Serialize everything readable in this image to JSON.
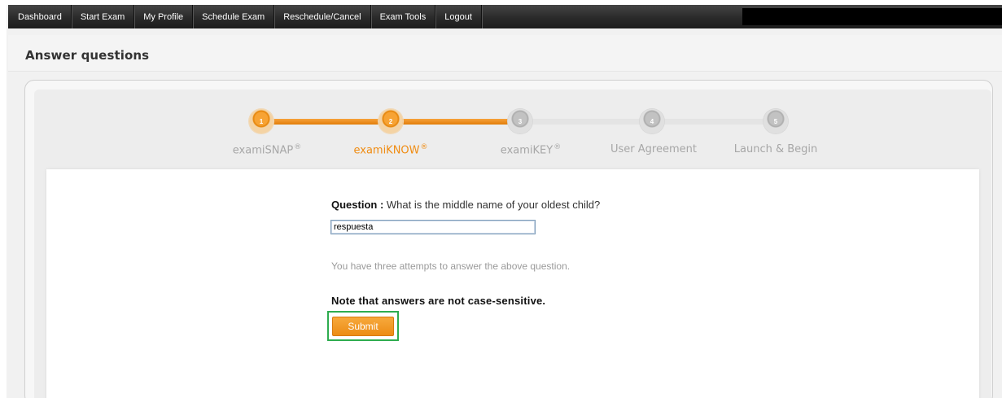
{
  "navbar": {
    "items": [
      "Dashboard",
      "Start Exam",
      "My Profile",
      "Schedule Exam",
      "Reschedule/Cancel",
      "Exam Tools",
      "Logout"
    ]
  },
  "page": {
    "title": "Answer questions"
  },
  "stepper": {
    "steps": [
      {
        "number": "1",
        "label": "examiSNAP",
        "mark": "®",
        "state": "done"
      },
      {
        "number": "2",
        "label": "examiKNOW",
        "mark": "®",
        "state": "active"
      },
      {
        "number": "3",
        "label": "examiKEY",
        "mark": "®",
        "state": "todo"
      },
      {
        "number": "4",
        "label": "User Agreement",
        "mark": "",
        "state": "todo"
      },
      {
        "number": "5",
        "label": "Launch & Begin",
        "mark": "",
        "state": "todo"
      }
    ]
  },
  "form": {
    "question_label": "Question :",
    "question_text": " What is the middle name of your oldest child?",
    "answer_value": "respuesta",
    "attempts_text": "You have three attempts to answer the above question.",
    "note_text": "Note that answers are not case-sensitive.",
    "submit_label": "Submit"
  },
  "colors": {
    "accent": "#f08c12",
    "highlight": "#2eac4f",
    "navbar": "#2a2a2a"
  }
}
